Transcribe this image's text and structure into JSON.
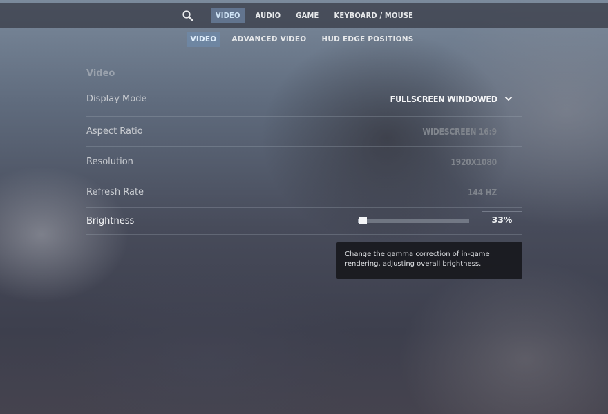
{
  "nav": {
    "search_icon": "search-icon",
    "tabs": [
      {
        "label": "VIDEO",
        "active": true
      },
      {
        "label": "AUDIO",
        "active": false
      },
      {
        "label": "GAME",
        "active": false
      },
      {
        "label": "KEYBOARD / MOUSE",
        "active": false
      }
    ]
  },
  "subnav": {
    "tabs": [
      {
        "label": "VIDEO",
        "active": true
      },
      {
        "label": "ADVANCED VIDEO",
        "active": false
      },
      {
        "label": "HUD EDGE POSITIONS",
        "active": false
      }
    ]
  },
  "section": {
    "title": "Video"
  },
  "settings": {
    "display_mode": {
      "label": "Display Mode",
      "value": "FULLSCREEN WINDOWED"
    },
    "aspect_ratio": {
      "label": "Aspect Ratio",
      "value": "WIDESCREEN 16:9"
    },
    "resolution": {
      "label": "Resolution",
      "value": "1920X1080"
    },
    "refresh_rate": {
      "label": "Refresh Rate",
      "value": "144 HZ"
    },
    "brightness": {
      "label": "Brightness",
      "value": "33%",
      "level": 0.02
    }
  },
  "tooltip": {
    "text": "Change the gamma correction of in-game rendering, adjusting overall brightness."
  },
  "colors": {
    "active_tab_bg": "#7896b9",
    "tooltip_bg": "#18191d"
  }
}
